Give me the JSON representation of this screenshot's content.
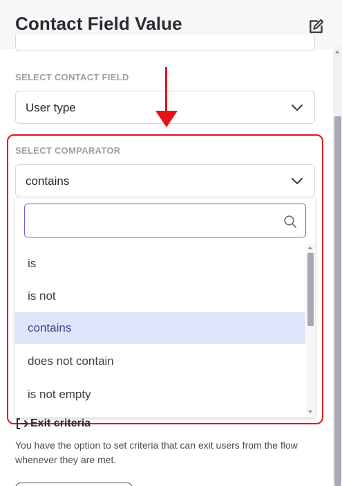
{
  "header": {
    "title": "Contact Field Value",
    "edit_icon": "edit-pencil-icon"
  },
  "contact_field": {
    "label": "SELECT CONTACT FIELD",
    "value": "User type"
  },
  "comparator": {
    "label": "SELECT COMPARATOR",
    "value": "contains",
    "search_placeholder": "",
    "options": [
      {
        "label": "is",
        "selected": false
      },
      {
        "label": "is not",
        "selected": false
      },
      {
        "label": "contains",
        "selected": true
      },
      {
        "label": "does not contain",
        "selected": false
      },
      {
        "label": "is not empty",
        "selected": false
      }
    ]
  },
  "exit_criteria": {
    "heading": "Exit criteria",
    "description": "You have the option to set criteria that can exit users from the flow whenever they are met."
  },
  "colors": {
    "annotation_red": "#e5121b",
    "accent_purple": "#6f5dd3",
    "selected_bg": "#e0e4fb"
  }
}
